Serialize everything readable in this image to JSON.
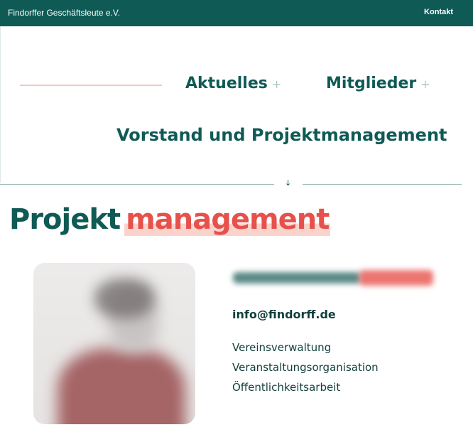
{
  "header": {
    "brand": "Findorffer Geschäftsleute e.V.",
    "contact_label": "Kontakt"
  },
  "nav": {
    "items": [
      {
        "label": "Aktuelles",
        "expand_glyph": "+"
      },
      {
        "label": "Mitglieder",
        "expand_glyph": "+"
      },
      {
        "label": "Vorstand und Projektmanagement"
      }
    ],
    "scroll_arrow": "↓"
  },
  "section": {
    "heading_part1": "Projekt",
    "heading_part2": "management"
  },
  "profile": {
    "photo_icon": "blurred-portrait",
    "email": "info@findorff.de",
    "tasks": [
      "Vereinsverwaltung",
      "Veranstaltungsorganisation",
      "Öffentlichkeitsarbeit"
    ]
  },
  "colors": {
    "brand_green": "#0f5a55",
    "accent_red": "#e6514b",
    "highlight_pink": "#fbd3cd"
  }
}
